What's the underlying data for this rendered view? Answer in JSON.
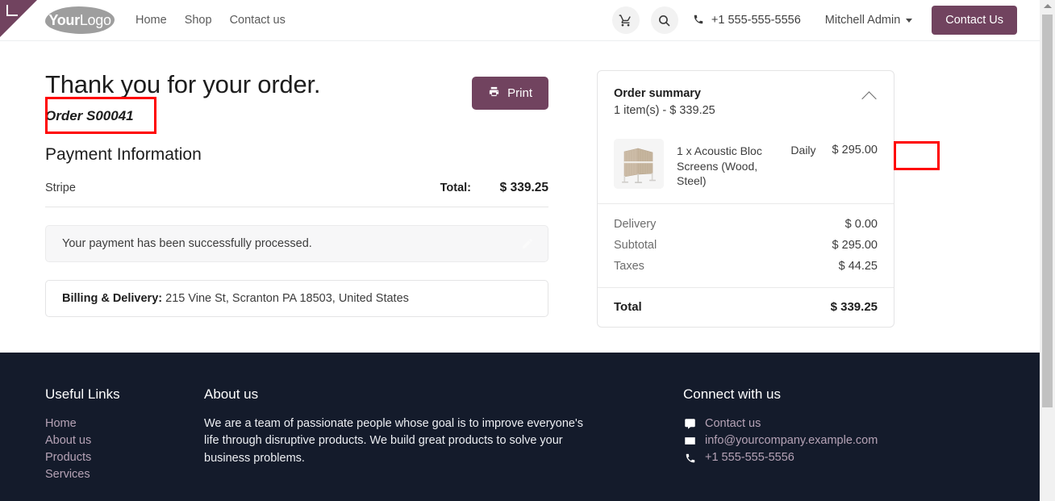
{
  "header": {
    "logo_bold": "Your",
    "logo_light": "Logo",
    "nav": [
      {
        "label": "Home"
      },
      {
        "label": "Shop"
      },
      {
        "label": "Contact us"
      }
    ],
    "cart_icon": "shopping-cart-icon",
    "search_icon": "search-icon",
    "phone_icon": "phone-icon",
    "phone": "+1 555-555-5556",
    "user_name": "Mitchell Admin",
    "contact_button": "Contact Us"
  },
  "main": {
    "heading": "Thank you for your order.",
    "order_reference": "Order S00041",
    "print_button": "Print",
    "print_icon": "printer-icon",
    "payment_section_title": "Payment Information",
    "payment_provider": "Stripe",
    "total_label": "Total:",
    "total_value": "$ 339.25",
    "payment_status_message": "Your payment has been successfully processed.",
    "edit_icon": "pencil-icon",
    "address_label": "Billing & Delivery:",
    "address_value": "215 Vine St, Scranton PA 18503, United States"
  },
  "order_summary": {
    "title": "Order summary",
    "subtitle": "1 item(s) -  $ 339.25",
    "collapse_icon": "chevron-up-icon",
    "items": [
      {
        "name": "1 x Acoustic Bloc Screens (Wood, Steel)",
        "plan": "Daily",
        "price": "$ 295.00",
        "thumbnail": "acoustic-bloc-screens-image"
      }
    ],
    "totals": [
      {
        "label": "Delivery",
        "value": "$ 0.00"
      },
      {
        "label": "Subtotal",
        "value": "$ 295.00"
      },
      {
        "label": "Taxes",
        "value": "$ 44.25"
      }
    ],
    "grand_total_label": "Total",
    "grand_total_value": "$ 339.25"
  },
  "footer": {
    "useful_links_title": "Useful Links",
    "useful_links": [
      {
        "label": "Home"
      },
      {
        "label": "About us"
      },
      {
        "label": "Products"
      },
      {
        "label": "Services"
      }
    ],
    "about_title": "About us",
    "about_text": "We are a team of passionate people whose goal is to improve everyone's life through disruptive products. We build great products to solve your business problems.",
    "connect_title": "Connect with us",
    "connect": [
      {
        "icon": "comment-icon",
        "label": "Contact us"
      },
      {
        "icon": "envelope-icon",
        "label": "info@yourcompany.example.com"
      },
      {
        "icon": "phone-icon",
        "label": "+1 555-555-5556"
      }
    ]
  },
  "annotations": [
    {
      "name": "order-reference-highlight",
      "color": "#ff0000"
    },
    {
      "name": "daily-plan-highlight",
      "color": "#ff0000"
    }
  ],
  "theme": {
    "brand_purple": "#71435f",
    "footer_bg": "#141b2b",
    "footer_link": "#b6a3b6",
    "annotation_red": "#ff0000"
  }
}
